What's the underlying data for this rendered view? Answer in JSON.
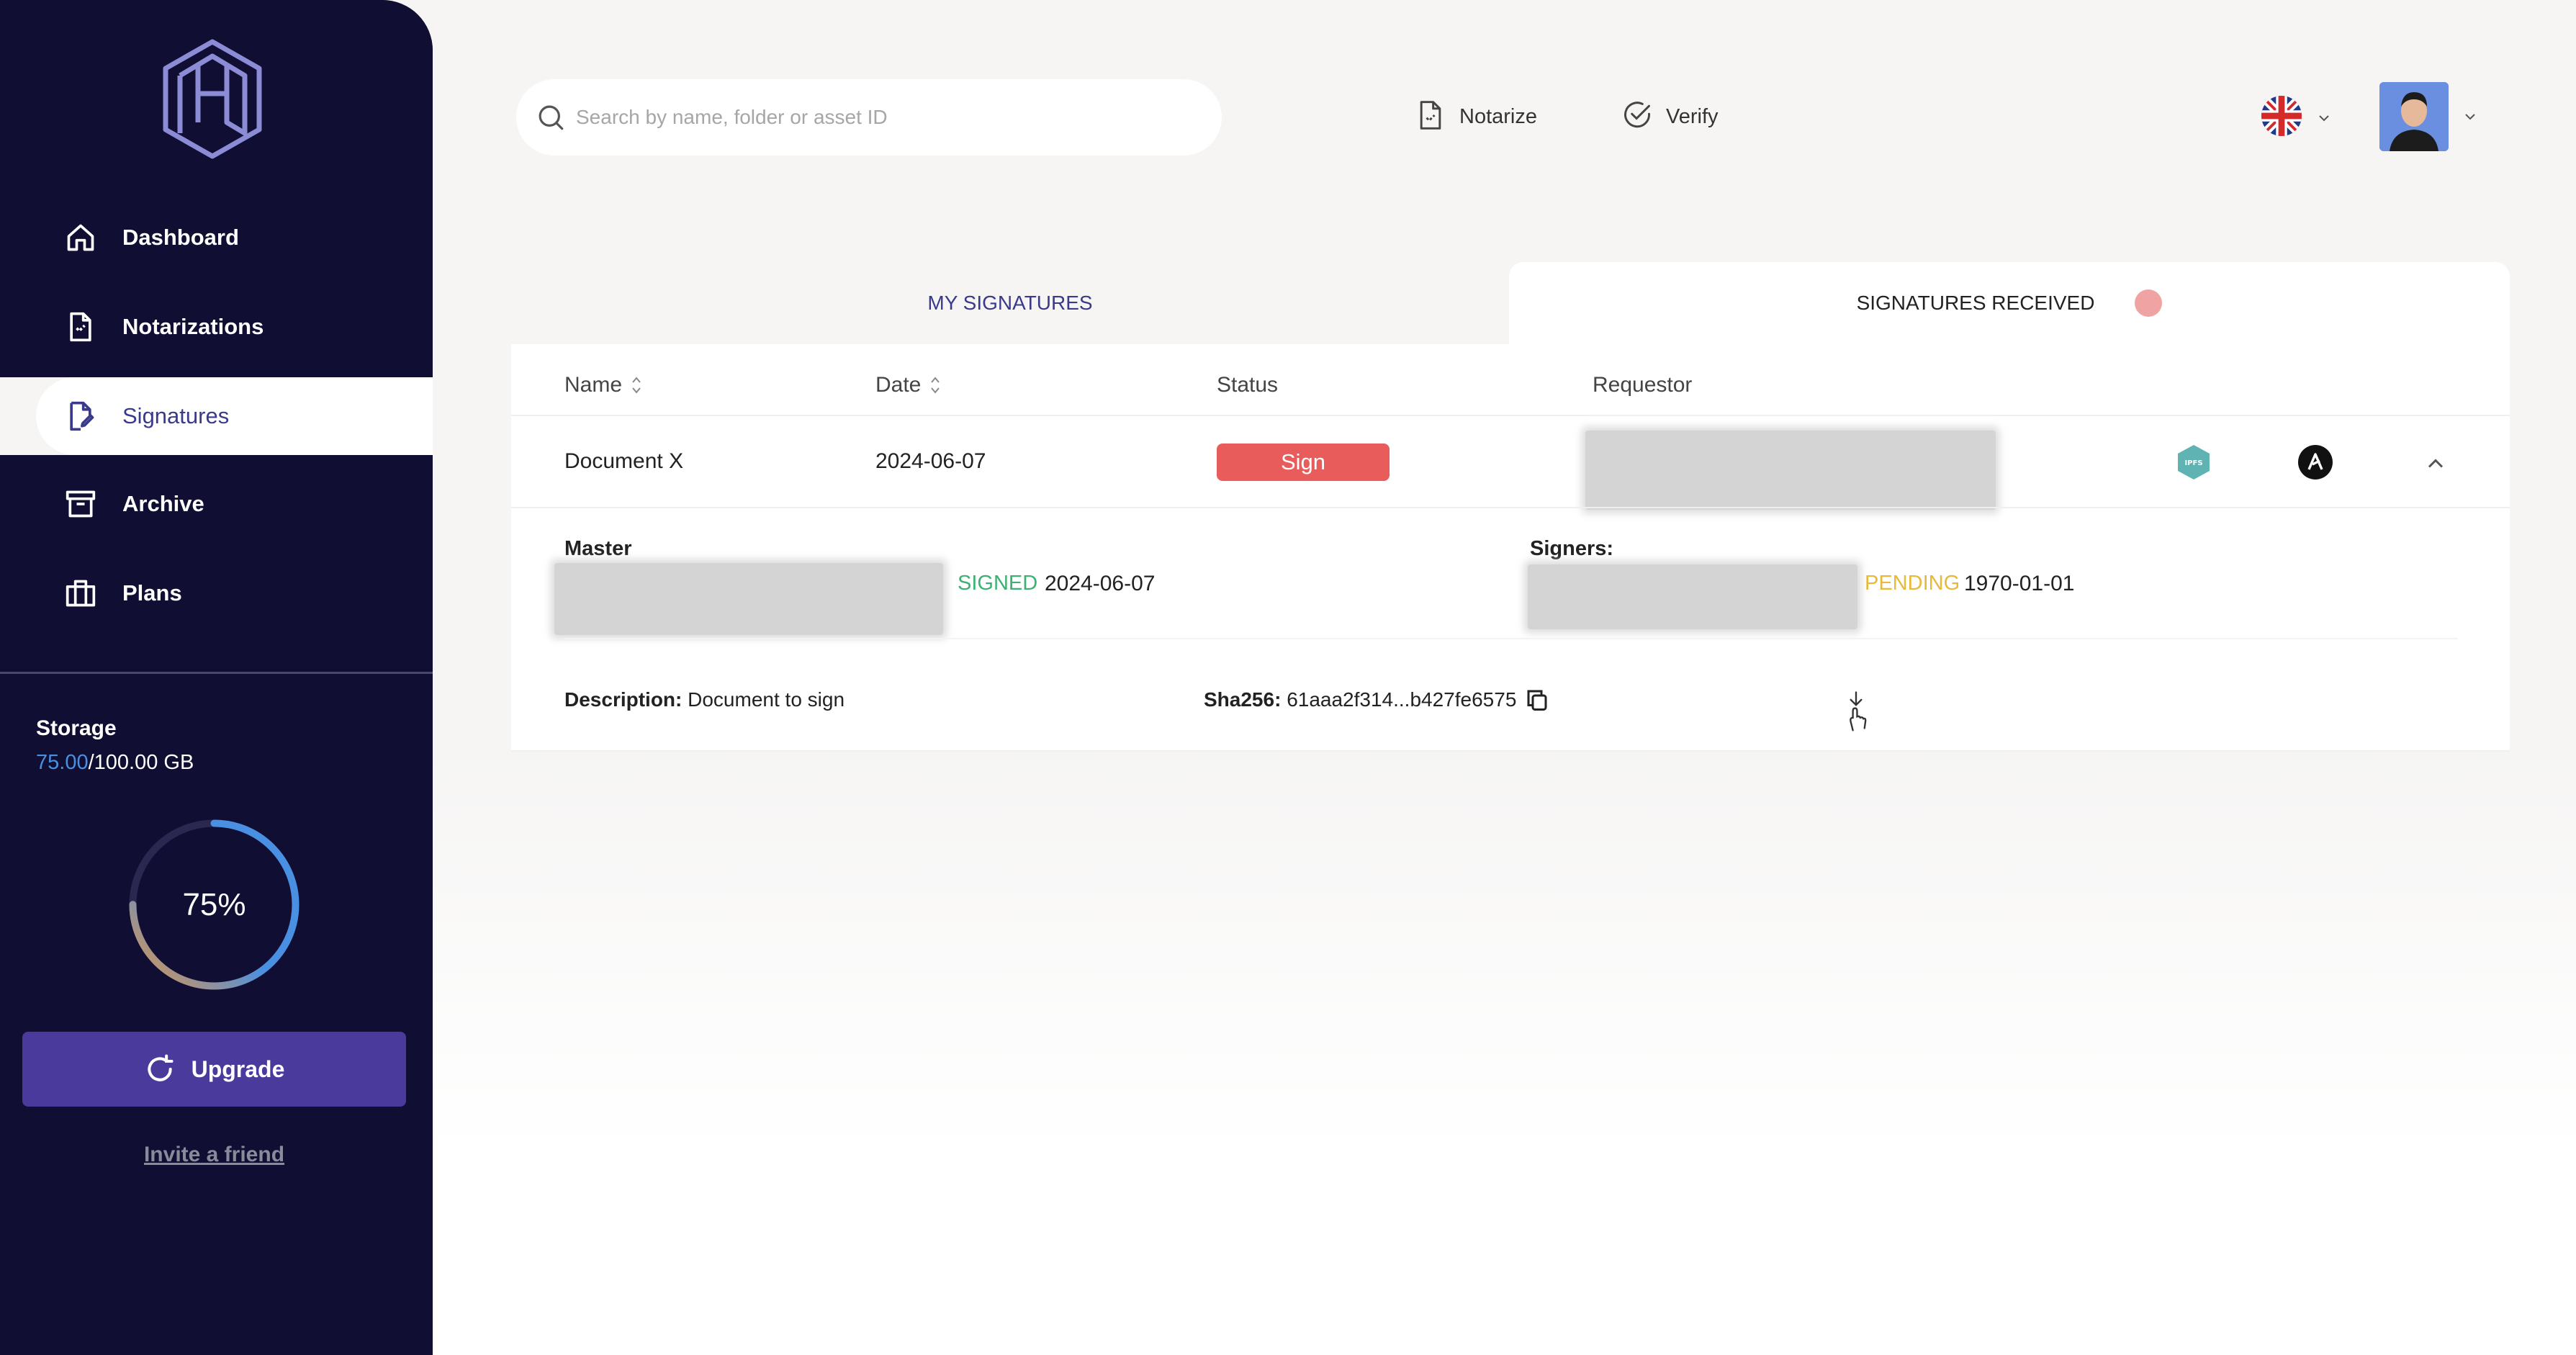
{
  "sidebar": {
    "logo": "hn-logo",
    "items": [
      {
        "label": "Dashboard",
        "icon": "home-icon"
      },
      {
        "label": "Notarizations",
        "icon": "document-icon"
      },
      {
        "label": "Signatures",
        "icon": "signature-icon",
        "active": true
      },
      {
        "label": "Archive",
        "icon": "archive-box-icon"
      },
      {
        "label": "Plans",
        "icon": "briefcase-icon"
      }
    ],
    "storage": {
      "title": "Storage",
      "used": "75.00",
      "total": "/100.00 GB",
      "percent_label": "75%",
      "percent": 75
    },
    "upgrade_label": "Upgrade",
    "invite_label": "Invite a friend"
  },
  "header": {
    "search_placeholder": "Search by name, folder or asset ID",
    "notarize_label": "Notarize",
    "verify_label": "Verify",
    "language_flag": "uk-flag-icon"
  },
  "tabs": {
    "my_signatures": "MY SIGNATURES",
    "signatures_received": "SIGNATURES RECEIVED"
  },
  "table": {
    "columns": {
      "name": "Name",
      "date": "Date",
      "status": "Status",
      "requestor": "Requestor"
    },
    "row": {
      "name": "Document X",
      "date": "2024-06-07",
      "action_label": "Sign"
    },
    "details": {
      "master_label": "Master",
      "master_status": "SIGNED",
      "master_date": "2024-06-07",
      "signers_label": "Signers:",
      "signer_status": "PENDING",
      "signer_date": "1970-01-01",
      "description_label": "Description:",
      "description_value": "Document to sign",
      "sha_label": "Sha256:",
      "sha_value": "61aaa2f314...b427fe6575"
    }
  },
  "colors": {
    "sidebar_bg": "#100e33",
    "accent": "#4a3a9c",
    "sign_button": "#e85c5c",
    "signed": "#3bb273",
    "pending": "#e8b93a",
    "storage_used": "#4a90e2"
  }
}
